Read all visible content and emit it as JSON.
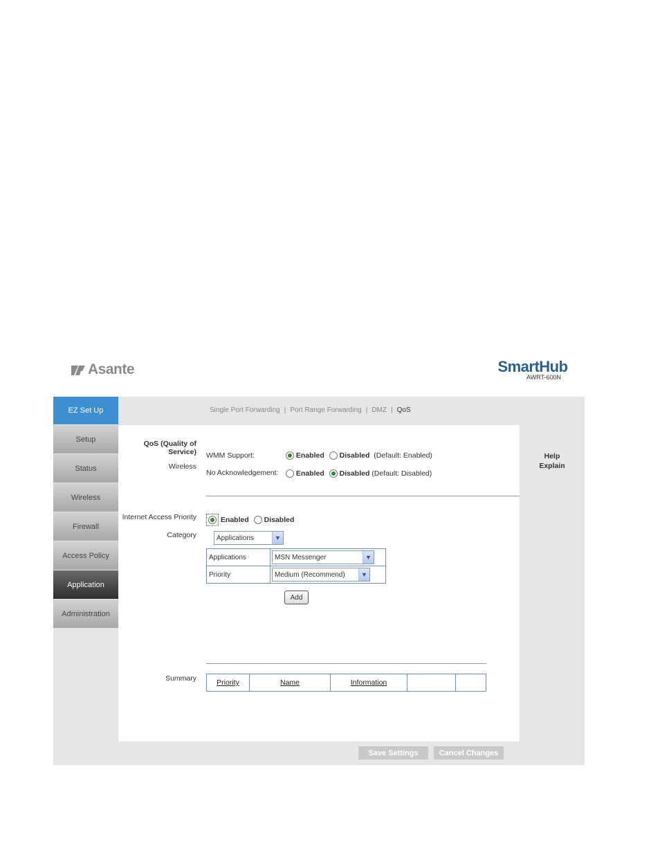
{
  "brand": {
    "asante": "Asante",
    "product": "SmartHub",
    "model": "AWRT-600N"
  },
  "sidebar": {
    "items": [
      {
        "label": "EZ Set Up"
      },
      {
        "label": "Setup"
      },
      {
        "label": "Status"
      },
      {
        "label": "Wireless"
      },
      {
        "label": "Firewall"
      },
      {
        "label": "Access Policy"
      },
      {
        "label": "Application"
      },
      {
        "label": "Administration"
      }
    ],
    "active": "Application"
  },
  "subnav": {
    "items": [
      "Single Port Forwarding",
      "Port Range Forwarding",
      "DMZ",
      "QoS"
    ],
    "separator": "|",
    "current": "QoS"
  },
  "qos": {
    "section_label_line1": "QoS (Quality of",
    "section_label_line2": "Service)",
    "wireless_label": "Wireless",
    "wmm_label": "WMM Support:",
    "wmm_enabled": "Enabled",
    "wmm_disabled": "Disabled",
    "wmm_default": "(Default: Enabled)",
    "wmm_value": "Enabled",
    "noack_label": "No Acknowledgement:",
    "noack_enabled": "Enabled",
    "noack_disabled": "Disabled",
    "noack_default": "(Default: Disabled)",
    "noack_value": "Disabled"
  },
  "priority": {
    "label": "Internet Access Priority",
    "enabled": "Enabled",
    "disabled": "Disabled",
    "value": "Enabled",
    "category_label": "Category",
    "category_value": "Applications",
    "applications_label": "Applications",
    "applications_value": "MSN Messenger",
    "priority_label": "Priority",
    "priority_value": "Medium (Recommend)",
    "add_button": "Add"
  },
  "help": {
    "line1": "Help",
    "line2": "Explain"
  },
  "summary": {
    "label": "Summary",
    "columns": [
      "Priority",
      "Name",
      "Information",
      "",
      ""
    ]
  },
  "footer": {
    "save": "Save Settings",
    "cancel": "Cancel Changes"
  }
}
